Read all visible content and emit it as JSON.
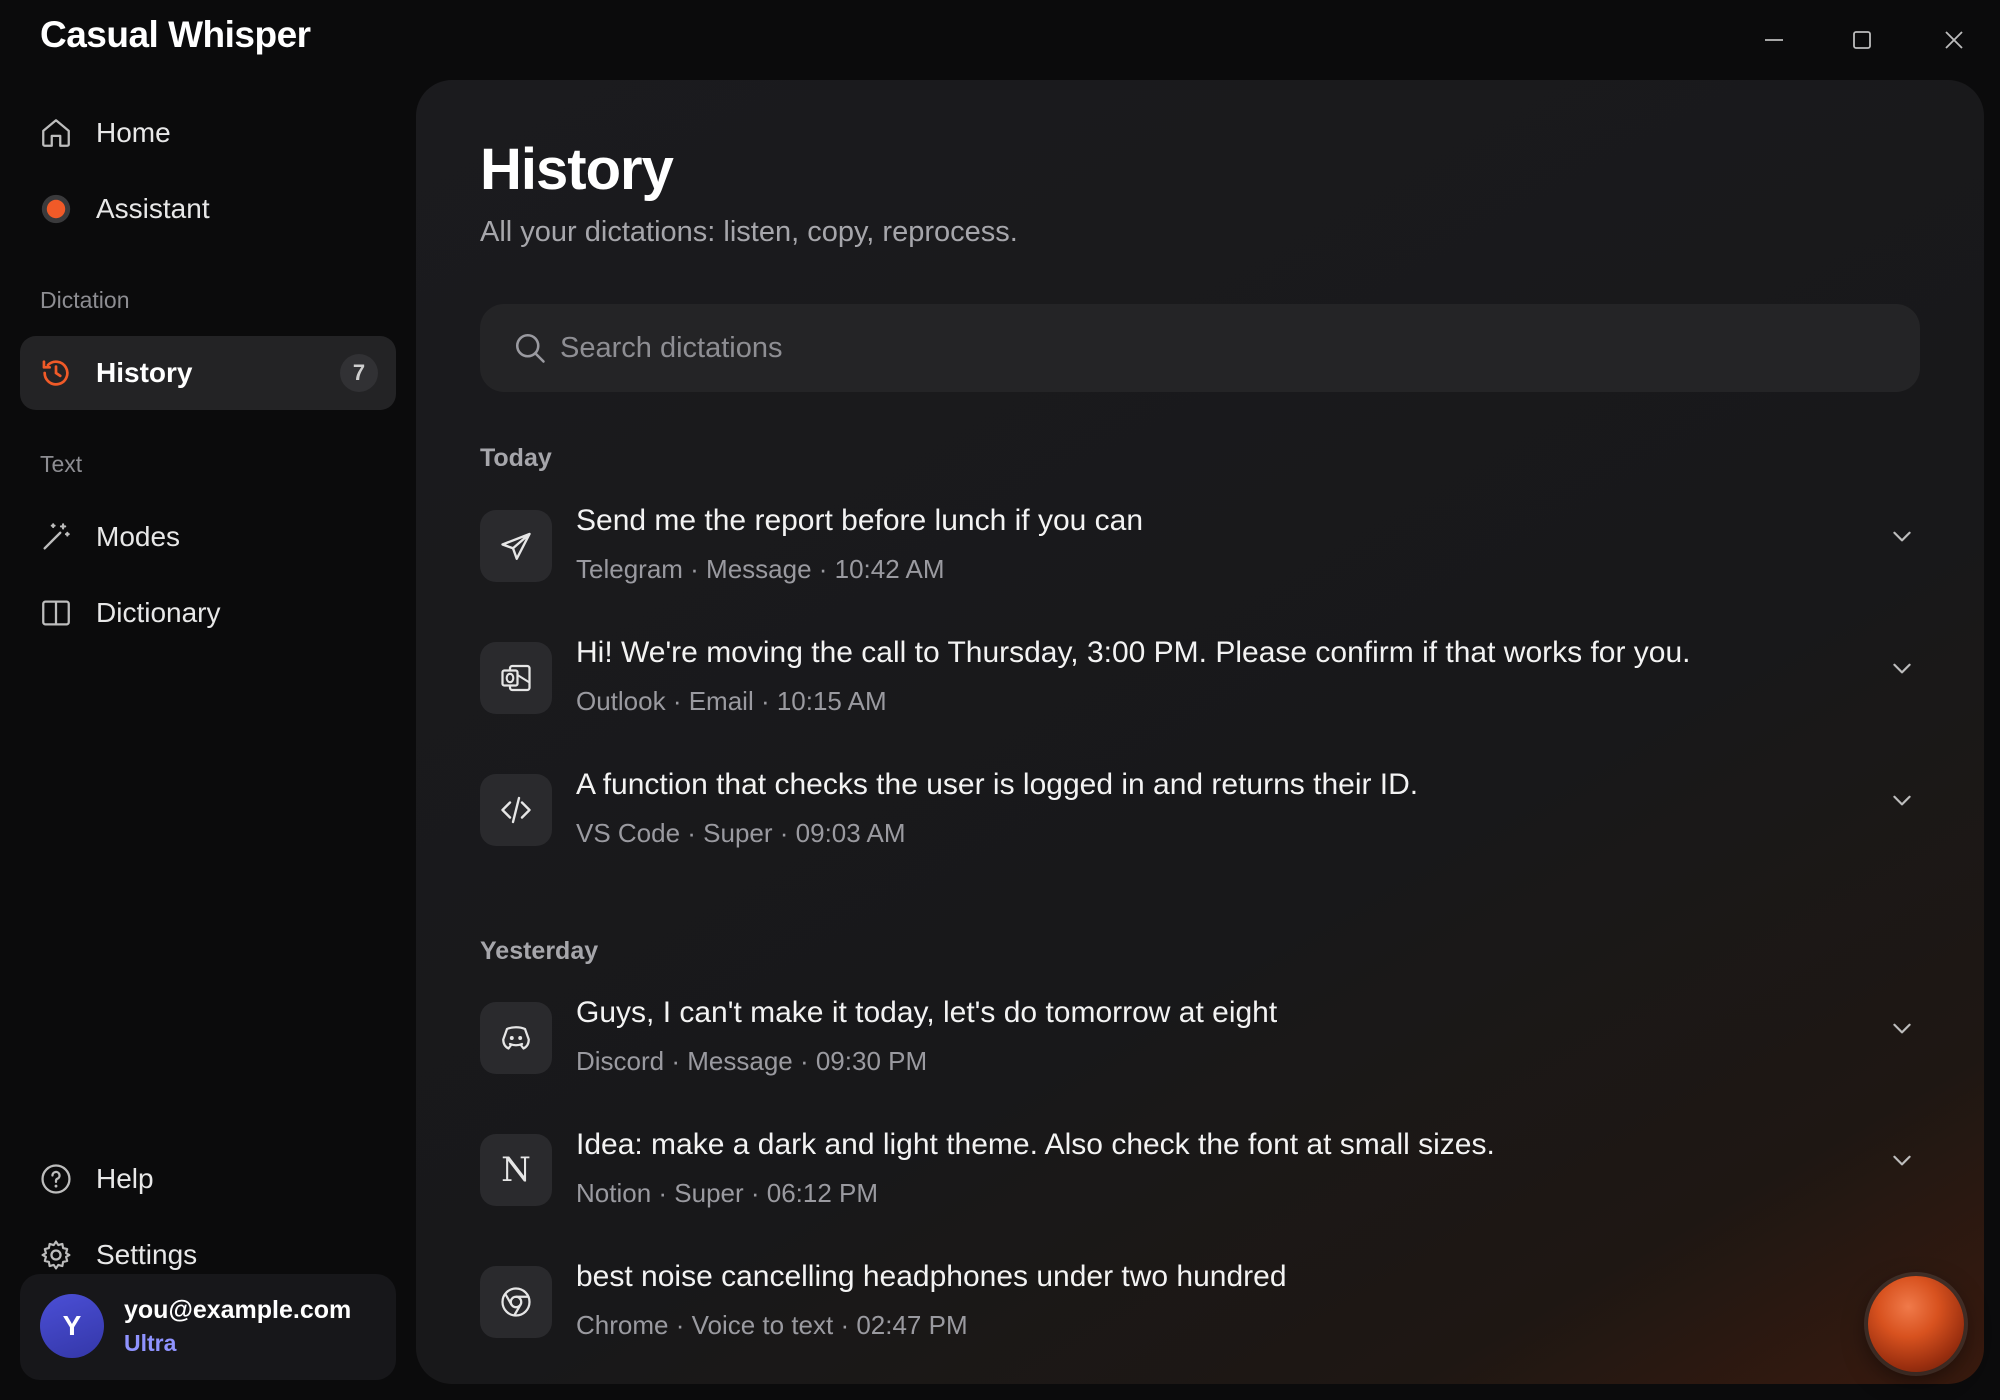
{
  "app": {
    "title": "Casual Whisper"
  },
  "window_controls": {
    "minimize_icon": "minimize-icon",
    "maximize_icon": "maximize-icon",
    "close_icon": "close-icon"
  },
  "sidebar": {
    "home": {
      "label": "Home",
      "icon": "home-icon"
    },
    "assistant": {
      "label": "Assistant",
      "icon": "assistant-dot-icon"
    },
    "dictation_section": "Dictation",
    "history": {
      "label": "History",
      "count": "7",
      "icon": "history-icon"
    },
    "text_section": "Text",
    "modes": {
      "label": "Modes",
      "icon": "wand-icon"
    },
    "dictionary": {
      "label": "Dictionary",
      "icon": "book-icon"
    },
    "help": {
      "label": "Help",
      "icon": "help-icon"
    },
    "settings": {
      "label": "Settings",
      "icon": "gear-icon"
    },
    "account": {
      "initial": "Y",
      "email": "you@example.com",
      "plan": "Ultra"
    }
  },
  "main": {
    "title": "History",
    "subtitle": "All your dictations: listen, copy, reprocess.",
    "search": {
      "placeholder": "Search dictations",
      "value": ""
    },
    "groups": [
      {
        "label": "Today",
        "entries": [
          {
            "text": "Send me the report before lunch if you can",
            "meta": "Telegram · Message · 10:42 AM",
            "icon": "telegram-icon"
          },
          {
            "text": "Hi! We're moving the call to Thursday, 3:00 PM. Please confirm if that works for you.",
            "meta": "Outlook · Email · 10:15 AM",
            "icon": "outlook-icon"
          },
          {
            "text": "A function that checks the user is logged in and returns their ID.",
            "meta": "VS Code · Super · 09:03 AM",
            "icon": "code-icon"
          }
        ]
      },
      {
        "label": "Yesterday",
        "entries": [
          {
            "text": "Guys, I can't make it today, let's do tomorrow at eight",
            "meta": "Discord · Message · 09:30 PM",
            "icon": "discord-icon"
          },
          {
            "text": "Idea: make a dark and light theme. Also check the font at small sizes.",
            "meta": "Notion · Super · 06:12 PM",
            "icon": "notion-icon",
            "letter": "N"
          },
          {
            "text": "best noise cancelling headphones under two hundred",
            "meta": "Chrome · Voice to text · 02:47 PM",
            "icon": "chrome-icon"
          }
        ]
      }
    ]
  },
  "colors": {
    "accent": "#e8542a",
    "plan": "#8f93ff",
    "avatar": "#4b4fd6",
    "background": "#0b0b0c",
    "panel": "#1b1b1e"
  }
}
